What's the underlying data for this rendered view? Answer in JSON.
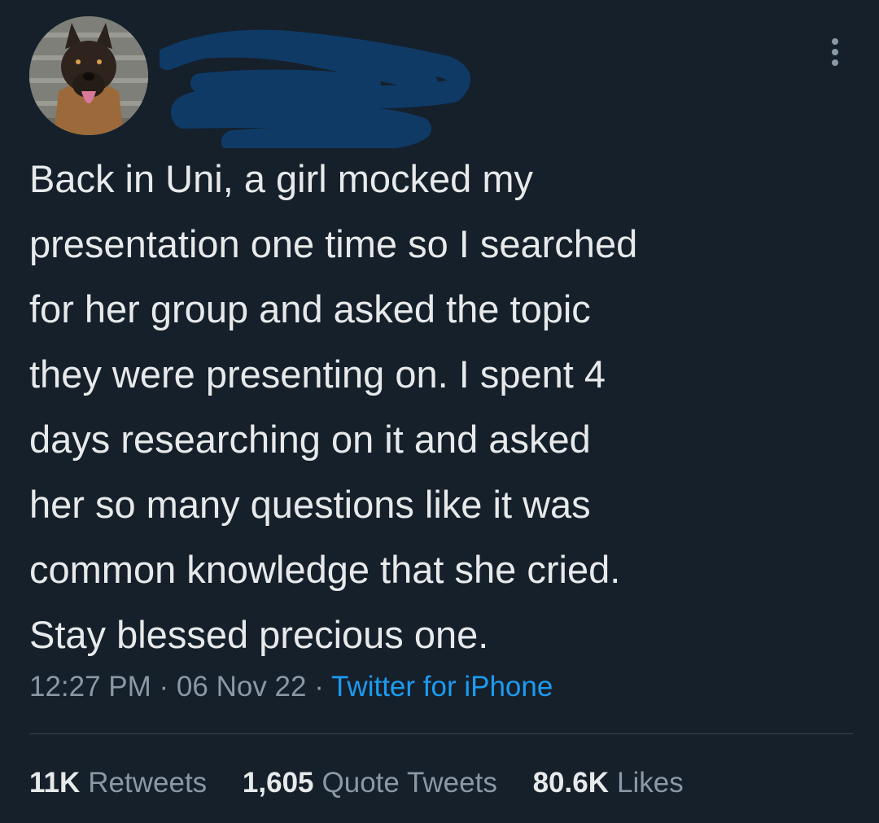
{
  "tweet": {
    "avatar_icon": "german-shepherd-dog-avatar",
    "username_redacted": true,
    "more_icon": "more-vertical-icon",
    "text": "Back in Uni, a girl mocked my\npresentation one time so I searched\nfor her group and asked the topic\nthey were presenting on. I spent 4\ndays researching on it and asked\nher so many questions like it was\ncommon knowledge that she cried.\nStay blessed precious one.",
    "time": "12:27 PM",
    "date": "06 Nov 22",
    "separator": " · ",
    "source": "Twitter for iPhone"
  },
  "stats": {
    "retweets": {
      "count": "11K",
      "label": "Retweets"
    },
    "quotes": {
      "count": "1,605",
      "label": "Quote Tweets"
    },
    "likes": {
      "count": "80.6K",
      "label": "Likes"
    }
  },
  "colors": {
    "background": "#15202b",
    "text": "#e7e9ea",
    "muted": "#8b98a5",
    "link": "#1d9bf0",
    "redaction": "#0f3a66"
  }
}
